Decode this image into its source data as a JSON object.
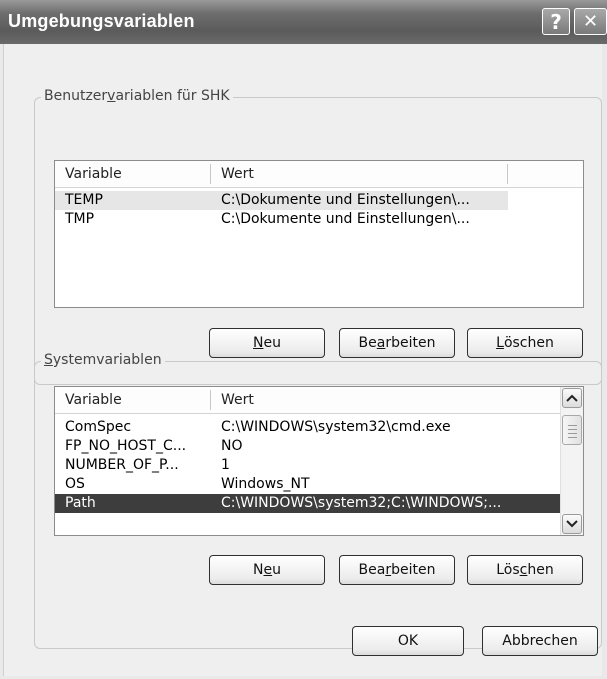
{
  "window": {
    "title": "Umgebungsvariablen",
    "help_glyph": "?",
    "close_glyph": "✕"
  },
  "user_group": {
    "legend_pre": "Benutzer",
    "legend_acc": "v",
    "legend_post": "ariablen für SHK",
    "columns": [
      "Variable",
      "Wert"
    ],
    "rows": [
      {
        "variable": "TEMP",
        "value": "C:\\Dokumente und Einstellungen\\..."
      },
      {
        "variable": "TMP",
        "value": "C:\\Dokumente und Einstellungen\\..."
      }
    ],
    "selected_row": 0,
    "buttons": {
      "new": {
        "pre": "",
        "acc": "N",
        "post": "eu"
      },
      "edit": {
        "pre": "Be",
        "acc": "a",
        "post": "rbeiten"
      },
      "delete": {
        "pre": "",
        "acc": "L",
        "post": "öschen"
      }
    }
  },
  "system_group": {
    "legend_pre": "",
    "legend_acc": "S",
    "legend_post": "ystemvariablen",
    "columns": [
      "Variable",
      "Wert"
    ],
    "rows": [
      {
        "variable": "ComSpec",
        "value": "C:\\WINDOWS\\system32\\cmd.exe"
      },
      {
        "variable": "FP_NO_HOST_C...",
        "value": "NO"
      },
      {
        "variable": "NUMBER_OF_P...",
        "value": "1"
      },
      {
        "variable": "OS",
        "value": "Windows_NT"
      },
      {
        "variable": "Path",
        "value": "C:\\WINDOWS\\system32;C:\\WINDOWS;..."
      }
    ],
    "selected_row": 4,
    "buttons": {
      "new": {
        "pre": "N",
        "acc": "e",
        "post": "u"
      },
      "edit": {
        "pre": "Bea",
        "acc": "r",
        "post": "beiten"
      },
      "delete": {
        "pre": "Lös",
        "acc": "c",
        "post": "hen"
      }
    }
  },
  "footer": {
    "ok_label": "OK",
    "cancel_label": "Abbrechen"
  }
}
